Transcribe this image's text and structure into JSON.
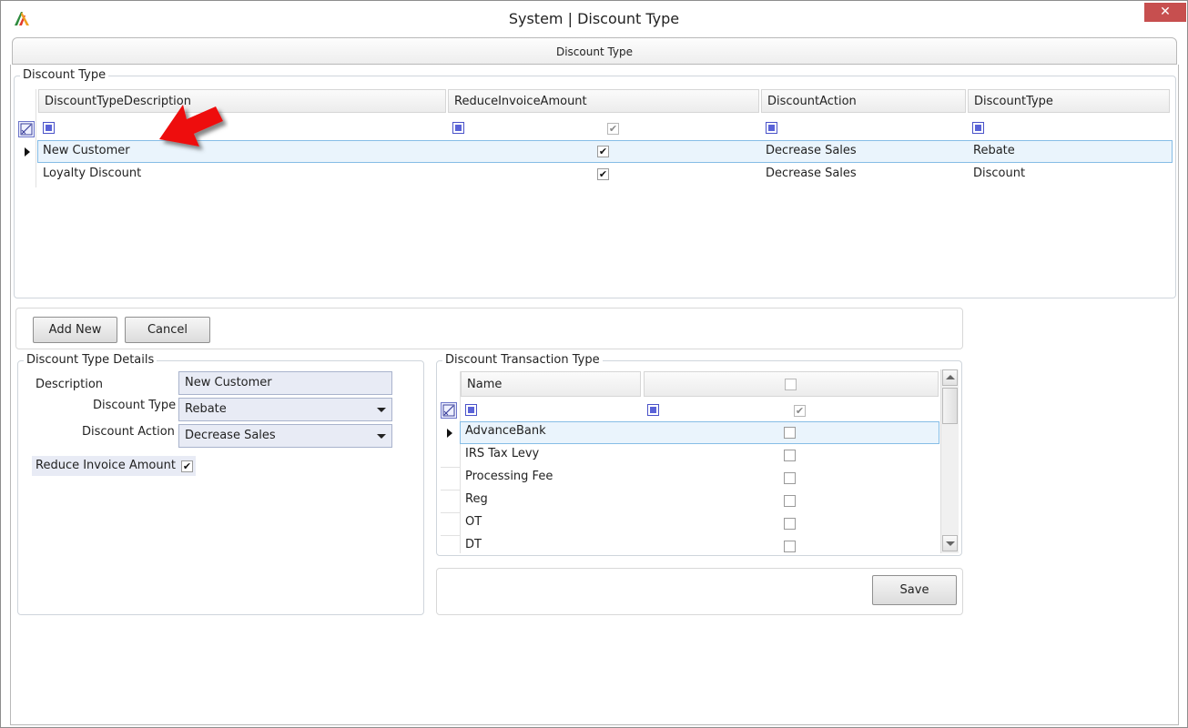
{
  "window": {
    "title": "System | Discount Type",
    "close_glyph": "✕",
    "logo_icon": "app-logo-icon"
  },
  "tab": {
    "label": "Discount Type"
  },
  "discount_type_grid": {
    "group_title": "Discount Type",
    "columns": [
      "DiscountTypeDescription",
      "ReduceInvoiceAmount",
      "DiscountAction",
      "DiscountType"
    ],
    "rows": [
      {
        "description": "New Customer",
        "reduce_invoice": true,
        "action": "Decrease Sales",
        "type": "Rebate"
      },
      {
        "description": "Loyalty Discount",
        "reduce_invoice": true,
        "action": "Decrease Sales",
        "type": "Discount"
      }
    ]
  },
  "actions": {
    "add_new": "Add New",
    "cancel": "Cancel",
    "save": "Save"
  },
  "details": {
    "group_title": "Discount Type Details",
    "description_label": "Description",
    "description_value": "New Customer",
    "discount_type_label": "Discount Type",
    "discount_type_value": "Rebate",
    "discount_action_label": "Discount Action",
    "discount_action_value": "Decrease Sales",
    "reduce_invoice_label": "Reduce Invoice Amount",
    "reduce_invoice_checked": true
  },
  "transaction_grid": {
    "group_title": "Discount Transaction Type",
    "column_name": "Name",
    "rows": [
      {
        "name": "AdvanceBank",
        "checked": false
      },
      {
        "name": "IRS Tax Levy",
        "checked": false
      },
      {
        "name": "Processing Fee",
        "checked": false
      },
      {
        "name": "Reg",
        "checked": false
      },
      {
        "name": "OT",
        "checked": false
      },
      {
        "name": "DT",
        "checked": false
      }
    ]
  },
  "colors": {
    "accent_red": "#c74f4f",
    "selection": "#eaf4fc",
    "selection_border": "#86bde6",
    "filter_blue": "#5a63d8",
    "annotation_arrow": "#ee1111"
  },
  "check_glyph": "✔"
}
